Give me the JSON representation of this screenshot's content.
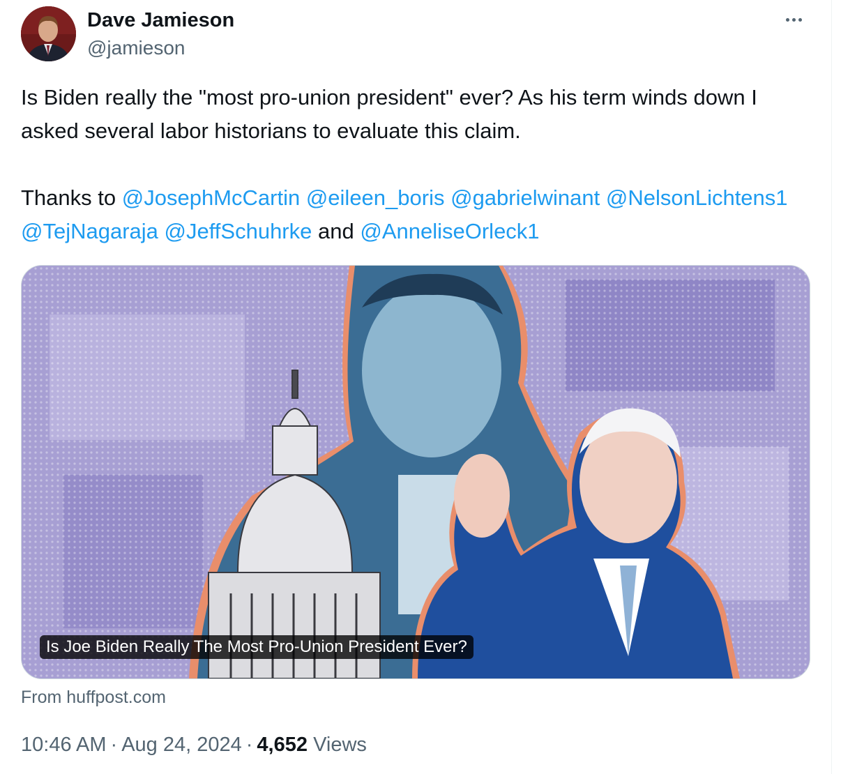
{
  "author": {
    "display_name": "Dave Jamieson",
    "handle": "@jamieson"
  },
  "tweet": {
    "line1_text": "Is Biden really the \"most pro-union president\" ever? As his term winds down I asked several labor historians to evaluate this claim.",
    "thanks_prefix": "Thanks to ",
    "mentions": [
      "@JosephMcCartin",
      "@eileen_boris",
      "@gabrielwinant",
      "@NelsonLichtens1",
      "@TejNagaraja",
      "@JeffSchuhrke",
      "@AnneliseOrleck1"
    ],
    "and_word": "and"
  },
  "card": {
    "title": "Is Joe Biden Really The Most Pro-Union President Ever?",
    "source": "From huffpost.com"
  },
  "meta": {
    "time": "10:46 AM",
    "separator": "·",
    "date": "Aug 24, 2024",
    "views_count": "4,652",
    "views_label": "Views"
  },
  "colors": {
    "text": "#0f1419",
    "secondary": "#536471",
    "link": "#1d9bf0",
    "card_bg": "#a79fd3"
  },
  "icons": {
    "more": "more-horizontal-icon"
  }
}
